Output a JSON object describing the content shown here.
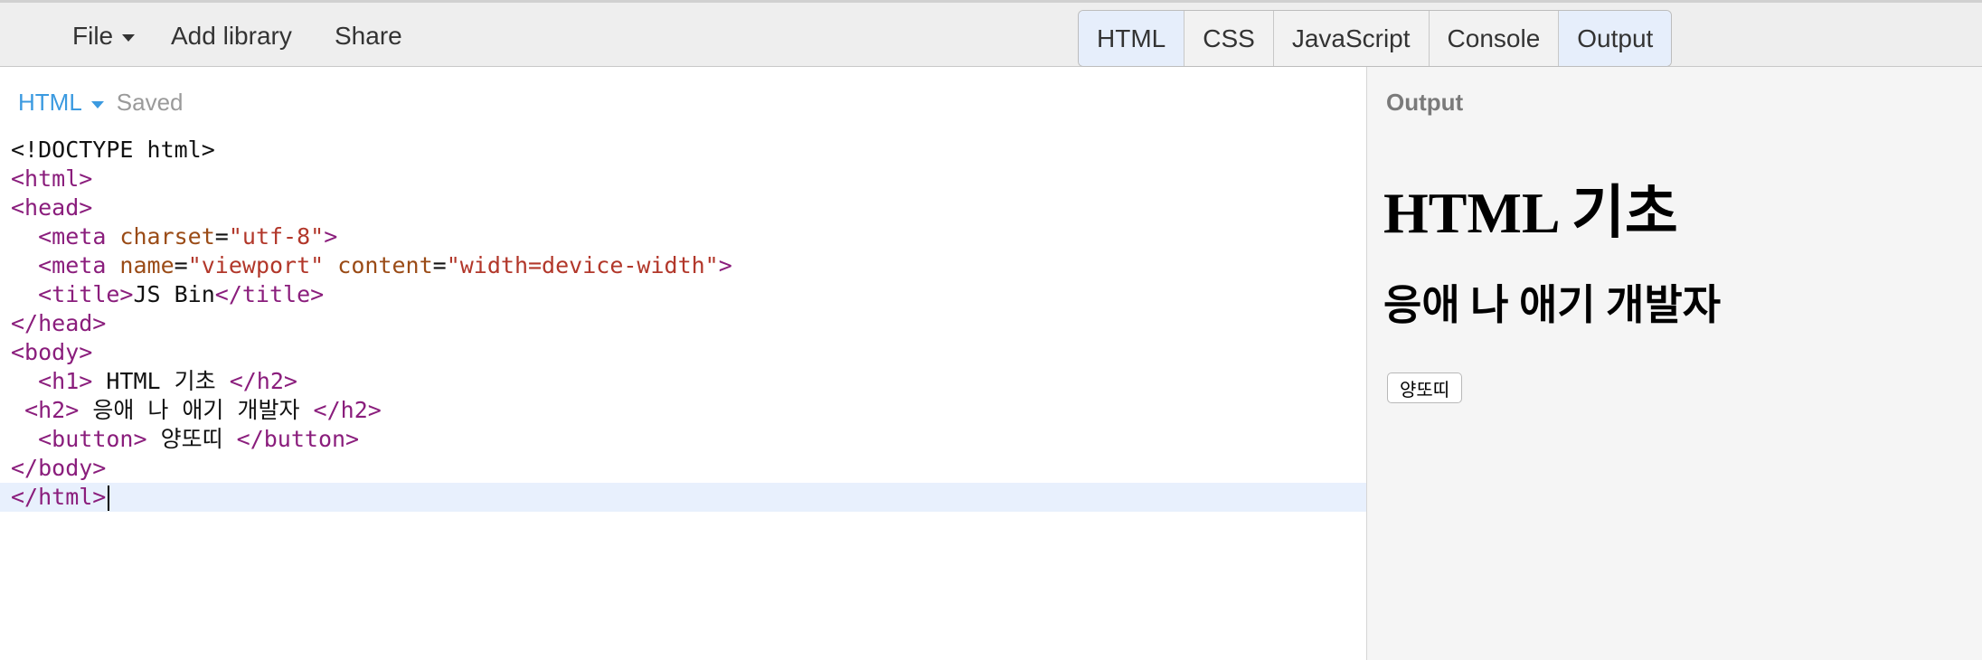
{
  "topbar": {
    "menu": {
      "file_label": "File",
      "add_library_label": "Add library",
      "share_label": "Share"
    },
    "panels": [
      {
        "label": "HTML",
        "active": true
      },
      {
        "label": "CSS",
        "active": false
      },
      {
        "label": "JavaScript",
        "active": false
      },
      {
        "label": "Console",
        "active": false
      },
      {
        "label": "Output",
        "active": true
      }
    ]
  },
  "editor": {
    "language": "HTML",
    "status": "Saved",
    "code_lines": [
      {
        "tag": "<!DOCTYPE html>"
      },
      {
        "tag": "<html>"
      },
      {
        "tag": "<head>"
      },
      {
        "indent": "  ",
        "open": "<meta ",
        "attr1": "charset",
        "eq1": "=",
        "val1": "\"utf-8\"",
        "close": ">"
      },
      {
        "indent": "  ",
        "open": "<meta ",
        "attr1": "name",
        "eq1": "=",
        "val1": "\"viewport\"",
        "sp": " ",
        "attr2": "content",
        "eq2": "=",
        "val2": "\"width=device-width\"",
        "close": ">"
      },
      {
        "indent": "  ",
        "open": "<title>",
        "text": "JS Bin",
        "close": "</title>"
      },
      {
        "tag": "</head>"
      },
      {
        "tag": "<body>"
      },
      {
        "indent": "  ",
        "open": "<h1>",
        "text": " HTML 기초 ",
        "close": "</h2>"
      },
      {
        "indent": " ",
        "open": "<h2>",
        "text": " 응애 나 애기 개발자 ",
        "close": "</h2>"
      },
      {
        "indent": "  ",
        "open": "<button>",
        "text": " 양또띠 ",
        "close": "</button>"
      },
      {
        "tag": "</body>"
      },
      {
        "tag": "</html>"
      }
    ]
  },
  "output": {
    "label": "Output",
    "h1": "HTML 기초",
    "h2": "응애 나 애기 개발자",
    "button": "양또띠"
  },
  "colors": {
    "accent_blue": "#3b9ae0",
    "tag": "#8a1d7c",
    "attribute": "#9a4b16",
    "string": "#b2372a",
    "active_tab": "#e6eefb"
  }
}
